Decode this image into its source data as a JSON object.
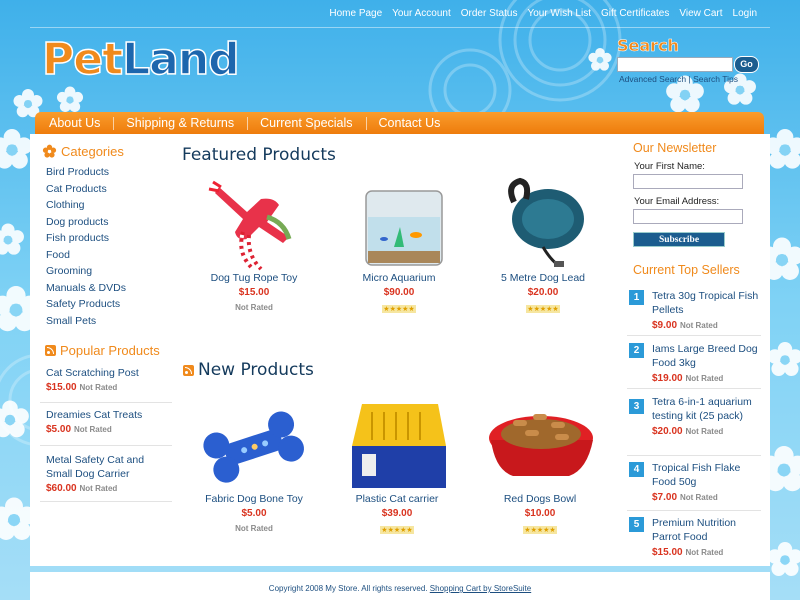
{
  "top_links": [
    "Home Page",
    "Your Account",
    "Order Status",
    "Your Wish List",
    "Gift Certificates",
    "View Cart",
    "Login"
  ],
  "logo": {
    "part1": "Pet",
    "part2": "Land"
  },
  "search": {
    "title": "Search",
    "placeholder": "",
    "go_label": "Go",
    "advanced": "Advanced Search",
    "sep": "|",
    "tips": "Search Tips"
  },
  "nav": [
    "About Us",
    "Shipping & Returns",
    "Current Specials",
    "Contact Us"
  ],
  "categories": {
    "title": "Categories",
    "items": [
      "Bird Products",
      "Cat Products",
      "Clothing",
      "Dog products",
      "Fish products",
      "Food",
      "Grooming",
      "Manuals & DVDs",
      "Safety Products",
      "Small Pets"
    ]
  },
  "popular": {
    "title": "Popular Products",
    "items": [
      {
        "name": "Cat Scratching Post",
        "price": "$15.00",
        "rating": "Not Rated"
      },
      {
        "name": "Dreamies Cat Treats",
        "price": "$5.00",
        "rating": "Not Rated"
      },
      {
        "name": "Metal Safety Cat and Small Dog Carrier",
        "price": "$60.00",
        "rating": "Not Rated"
      }
    ]
  },
  "featured": {
    "title": "Featured Products",
    "items": [
      {
        "name": "Dog Tug Rope Toy",
        "price": "$15.00",
        "rating": "Not Rated"
      },
      {
        "name": "Micro Aquarium",
        "price": "$90.00",
        "stars": 5
      },
      {
        "name": "5 Metre Dog Lead",
        "price": "$20.00",
        "stars": 5
      }
    ]
  },
  "new_products": {
    "title": "New Products",
    "items": [
      {
        "name": "Fabric Dog Bone Toy",
        "price": "$5.00",
        "rating": "Not Rated"
      },
      {
        "name": "Plastic Cat carrier",
        "price": "$39.00",
        "stars": 5
      },
      {
        "name": "Red Dogs Bowl",
        "price": "$10.00",
        "stars": 5
      }
    ]
  },
  "newsletter": {
    "title": "Our Newsletter",
    "first_name_label": "Your First Name:",
    "email_label": "Your Email Address:",
    "subscribe_label": "Subscribe"
  },
  "top_sellers": {
    "title": "Current Top Sellers",
    "items": [
      {
        "rank": "1",
        "name": "Tetra 30g Tropical Fish Pellets",
        "price": "$9.00",
        "rating": "Not Rated"
      },
      {
        "rank": "2",
        "name": "Iams Large Breed Dog Food 3kg",
        "price": "$19.00",
        "rating": "Not Rated"
      },
      {
        "rank": "3",
        "name": "Tetra 6-in-1 aquarium testing kit (25 pack)",
        "price": "$20.00",
        "rating": "Not Rated"
      },
      {
        "rank": "4",
        "name": "Tropical Fish Flake Food 50g",
        "price": "$7.00",
        "rating": "Not Rated"
      },
      {
        "rank": "5",
        "name": "Premium Nutrition Parrot Food",
        "price": "$15.00",
        "rating": "Not Rated"
      }
    ]
  },
  "footer": {
    "copyright": "Copyright 2008 My Store. All rights reserved.",
    "link": "Shopping Cart by StoreSuite"
  },
  "colors": {
    "orange": "#f08a1c",
    "blue_link": "#1d4f80",
    "price_red": "#d9331f",
    "sky": "#6fcaf2"
  }
}
